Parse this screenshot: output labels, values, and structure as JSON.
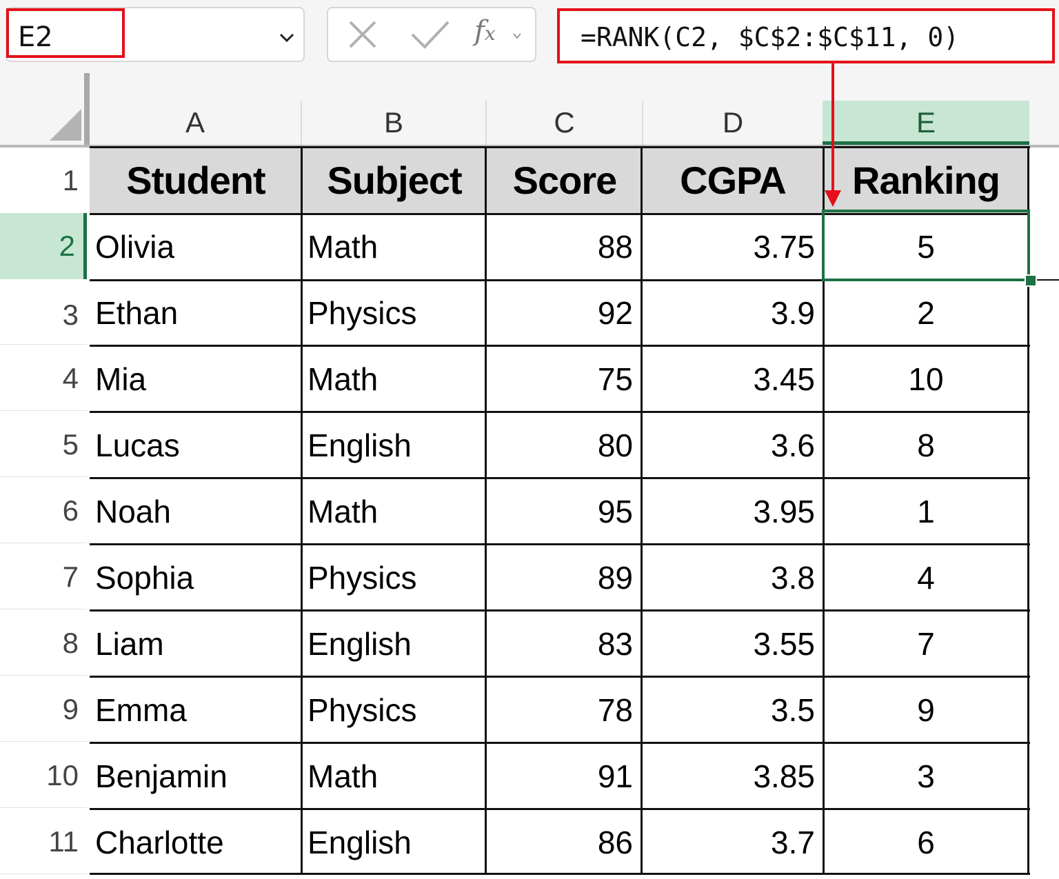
{
  "formula_bar": {
    "name_box": "E2",
    "formula": "=RANK(C2, $C$2:$C$11, 0)",
    "fx_label": "f",
    "fx_sub": "x"
  },
  "columns": [
    "A",
    "B",
    "C",
    "D",
    "E"
  ],
  "selected_column": "E",
  "rows": [
    "1",
    "2",
    "3",
    "4",
    "5",
    "6",
    "7",
    "8",
    "9",
    "10",
    "11"
  ],
  "selected_row": "2",
  "table": {
    "headers": [
      "Student",
      "Subject",
      "Score",
      "CGPA",
      "Ranking"
    ],
    "rows": [
      [
        "Olivia",
        "Math",
        "88",
        "3.75",
        "5"
      ],
      [
        "Ethan",
        "Physics",
        "92",
        "3.9",
        "2"
      ],
      [
        "Mia",
        "Math",
        "75",
        "3.45",
        "10"
      ],
      [
        "Lucas",
        "English",
        "80",
        "3.6",
        "8"
      ],
      [
        "Noah",
        "Math",
        "95",
        "3.95",
        "1"
      ],
      [
        "Sophia",
        "Physics",
        "89",
        "3.8",
        "4"
      ],
      [
        "Liam",
        "English",
        "83",
        "3.55",
        "7"
      ],
      [
        "Emma",
        "Physics",
        "78",
        "3.5",
        "9"
      ],
      [
        "Benjamin",
        "Math",
        "91",
        "3.85",
        "3"
      ],
      [
        "Charlotte",
        "English",
        "86",
        "3.7",
        "6"
      ]
    ]
  },
  "colors": {
    "highlight": "#e3101a",
    "selection": "#1e7145",
    "selection_fill": "#c7e6d3",
    "header_fill": "#d9d9d9"
  }
}
